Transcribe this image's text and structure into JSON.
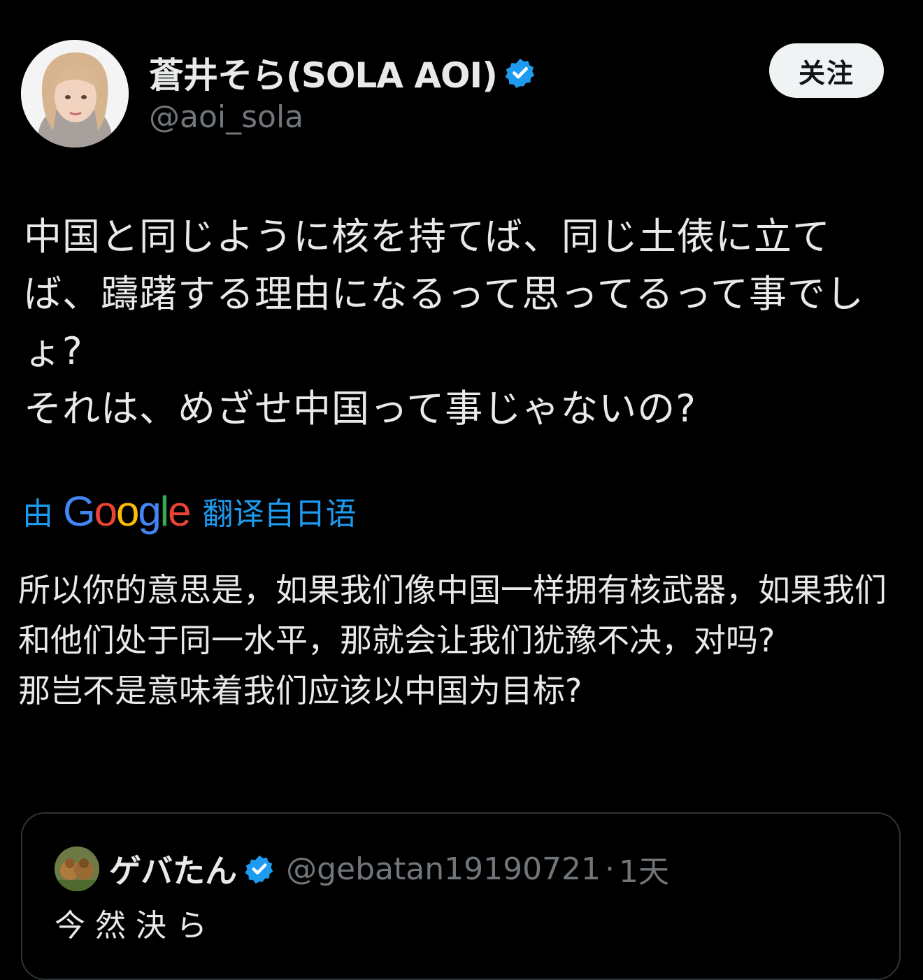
{
  "author": {
    "display_name": "蒼井そら(SOLA AOI)",
    "handle": "@aoi_sola",
    "verified": true
  },
  "follow_button": {
    "label": "关注"
  },
  "tweet": {
    "original_lines": [
      "中国と同じように核を持てば、同じ土俵に立てば、躊躇する理由になるって思ってるって事でしょ?",
      "それは、めざせ中国って事じゃないの?"
    ],
    "translate": {
      "prefix": "由",
      "google_letters": [
        "G",
        "o",
        "o",
        "g",
        "l",
        "e"
      ],
      "suffix": "翻译自日语"
    },
    "translated_lines": [
      "所以你的意思是，如果我们像中国一样拥有核武器，如果我们和他们处于同一水平，那就会让我们犹豫不决，对吗?",
      "那岂不是意味着我们应该以中国为目标?"
    ]
  },
  "quote": {
    "display_name": "ゲバたん",
    "handle": "@gebatan19190721",
    "separator": "·",
    "time": "1天",
    "text_preview": "今 然 決 ら"
  },
  "colors": {
    "background": "#000000",
    "text_primary": "#e7e9ea",
    "text_secondary": "#71767b",
    "accent_blue": "#1d9bf0",
    "verified_blue": "#1d9bf0",
    "follow_bg": "#eff3f4",
    "card_border": "#2f3336",
    "google_blue": "#4285f4",
    "google_red": "#ea4335",
    "google_yellow": "#fbbc05",
    "google_green": "#34a853"
  },
  "icons": {
    "verified": "verified-badge-icon",
    "translate_logo": "google-logo"
  }
}
